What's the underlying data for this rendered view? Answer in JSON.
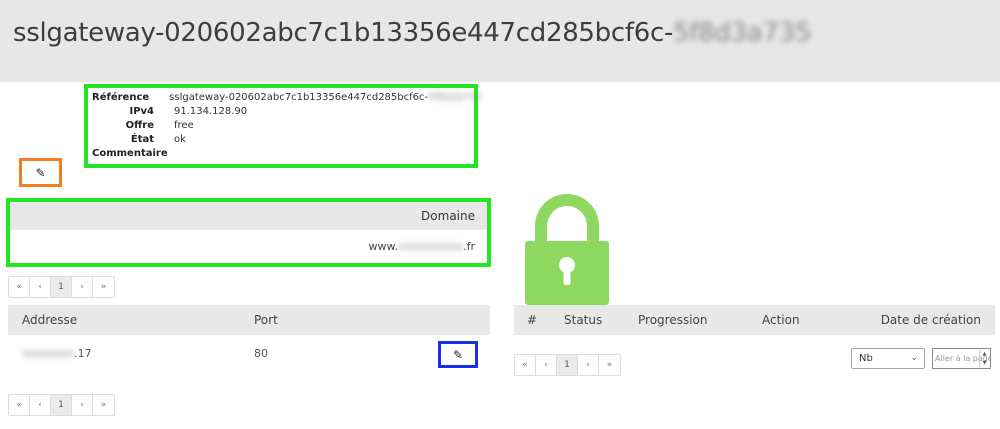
{
  "header": {
    "title_prefix": "sslgateway-020602abc7c1b13356e447cd285bcf6c-",
    "title_redacted": "5f8d3a735"
  },
  "info": {
    "rows": [
      {
        "label": "Référence",
        "value": "sslgateway-020602abc7c1b13356e447cd285bcf6c-",
        "redacted": "5f8d3a735"
      },
      {
        "label": "IPv4",
        "value": "91.134.128.90"
      },
      {
        "label": "Offre",
        "value": "free"
      },
      {
        "label": "État",
        "value": "ok"
      },
      {
        "label": "Commentaire",
        "value": ""
      }
    ]
  },
  "edit_icon": "pencil-icon",
  "domains": {
    "header": "Domaine",
    "rows": [
      {
        "prefix": "www.",
        "redacted": "xxxxxxxxxx",
        "suffix": ".fr"
      }
    ]
  },
  "pager": {
    "first": "«",
    "prev": "‹",
    "page": "1",
    "next": "›",
    "last": "»"
  },
  "addresses": {
    "columns": [
      "Addresse",
      "Port"
    ],
    "rows": [
      {
        "address_redacted": "xxxxxxxx",
        "address_suffix": ".17",
        "port": "80"
      }
    ]
  },
  "lock": {
    "icon": "lock-icon",
    "color": "#8ed85f"
  },
  "tasks": {
    "columns": [
      "#",
      "Status",
      "Progression",
      "Action",
      "Date de création"
    ],
    "page_size": {
      "selected": "Nb"
    },
    "goto": {
      "placeholder": "Aller à la page"
    }
  },
  "colors": {
    "highlight_green": "#22e622",
    "highlight_orange": "#f57c1f",
    "highlight_blue": "#1a2fe6"
  }
}
